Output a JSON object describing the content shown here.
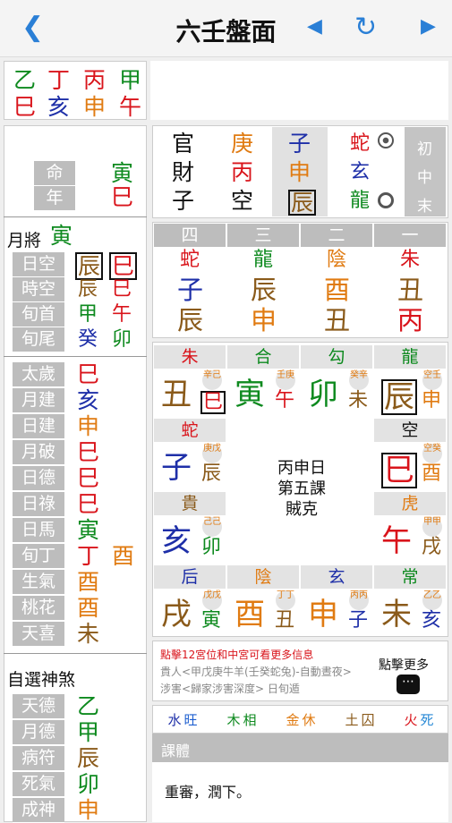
{
  "header": {
    "title": "六壬盤面"
  },
  "pillars": {
    "stems": [
      "乙",
      "丁",
      "丙",
      "甲"
    ],
    "branches": [
      "巳",
      "亥",
      "申",
      "午"
    ]
  },
  "life": {
    "ming_label": "命",
    "ming_val": "寅",
    "nian_label": "年",
    "nian_val": "巳"
  },
  "yuejiang": {
    "label": "月將",
    "val": "寅"
  },
  "kong": {
    "rikong": "日空",
    "shikong": "時空",
    "xunshou": "旬首",
    "xunwei": "旬尾",
    "rk1": "辰",
    "rk2": "巳",
    "sk1": "辰",
    "sk2": "巳",
    "xs1": "甲",
    "xs2": "午",
    "xw1": "癸",
    "xw2": "卯"
  },
  "shensha": [
    {
      "l": "太歲",
      "v": "巳"
    },
    {
      "l": "月建",
      "v": "亥"
    },
    {
      "l": "日建",
      "v": "申"
    },
    {
      "l": "月破",
      "v": "巳"
    },
    {
      "l": "日德",
      "v": "巳"
    },
    {
      "l": "日祿",
      "v": "巳"
    },
    {
      "l": "日馬",
      "v": "寅"
    },
    {
      "l": "旬丁",
      "v": "丁",
      "v2": "酉"
    },
    {
      "l": "生氣",
      "v": "酉"
    },
    {
      "l": "桃花",
      "v": "酉"
    },
    {
      "l": "天喜",
      "v": "未"
    }
  ],
  "zixuan": {
    "title": "自選神煞",
    "items": [
      {
        "l": "天德",
        "v": "乙"
      },
      {
        "l": "月德",
        "v": "甲"
      },
      {
        "l": "病符",
        "v": "辰"
      },
      {
        "l": "死氣",
        "v": "卯"
      },
      {
        "l": "成神",
        "v": "申"
      }
    ]
  },
  "sanchuan": {
    "liuqin": [
      "官",
      "財",
      "子"
    ],
    "dungan": [
      "庚",
      "丙",
      "空"
    ],
    "zhi": [
      "子",
      "申",
      "辰"
    ],
    "jiang": [
      "蛇",
      "玄",
      "龍"
    ],
    "labels": [
      "初",
      "中",
      "末"
    ]
  },
  "sike": {
    "heads": [
      "四",
      "三",
      "二",
      "一"
    ],
    "jiang": [
      "蛇",
      "龍",
      "陰",
      "朱"
    ],
    "up": [
      "子",
      "辰",
      "酉",
      "丑"
    ],
    "down": [
      "辰",
      "申",
      "丑",
      "丙"
    ]
  },
  "palaces": {
    "top": [
      {
        "h": "朱",
        "m": "丑",
        "s": "巳",
        "c": "辛己"
      },
      {
        "h": "合",
        "m": "寅",
        "s": "午",
        "c": "壬庚"
      },
      {
        "h": "勾",
        "m": "卯",
        "s": "未",
        "c": "癸辛"
      },
      {
        "h": "龍",
        "m": "辰",
        "s": "申",
        "c": "空壬"
      }
    ],
    "left": [
      {
        "h": "蛇",
        "m": "子",
        "s": "辰",
        "c": "庚戊"
      },
      {
        "h": "貴",
        "m": "亥",
        "s": "卯",
        "c": "己己"
      }
    ],
    "right": [
      {
        "h": "空",
        "m": "巳",
        "s": "酉",
        "c": "空癸"
      },
      {
        "h": "虎",
        "m": "午",
        "s": "戌",
        "c": "甲甲"
      }
    ],
    "bottom": [
      {
        "h": "后",
        "m": "戌",
        "s": "寅",
        "c": "戊戊"
      },
      {
        "h": "陰",
        "m": "酉",
        "s": "丑",
        "c": "丁丁"
      },
      {
        "h": "玄",
        "m": "申",
        "s": "子",
        "c": "丙丙"
      },
      {
        "h": "常",
        "m": "未",
        "s": "亥",
        "c": "乙乙"
      }
    ],
    "center": [
      "丙申日",
      "第五課",
      "賊克"
    ]
  },
  "info": {
    "hint": "點擊12宮位和中宮可看更多信息",
    "line1": "貴人<甲戊庚牛羊(壬癸蛇兔)-自動晝夜>",
    "line2": "涉害<歸家涉害深度> 日旬遁",
    "more": "點擊更多"
  },
  "wuxing": [
    {
      "e": "水",
      "s": "旺"
    },
    {
      "e": "木",
      "s": "相"
    },
    {
      "e": "金",
      "s": "休"
    },
    {
      "e": "土",
      "s": "囚"
    },
    {
      "e": "火",
      "s": "死"
    }
  ],
  "keti": {
    "label": "課體",
    "text": "重審，潤下。"
  }
}
